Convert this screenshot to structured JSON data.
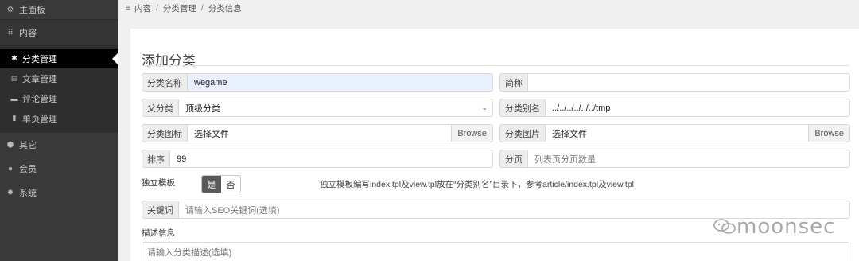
{
  "sidebar": {
    "home": {
      "icon": "dashboard-icon",
      "label": "主面板"
    },
    "content": {
      "icon": "grid-icon",
      "label": "内容"
    },
    "content_items": [
      {
        "icon": "asterisk-icon",
        "label": "分类管理",
        "active": true
      },
      {
        "icon": "book-icon",
        "label": "文章管理"
      },
      {
        "icon": "comment-icon",
        "label": "评论管理"
      },
      {
        "icon": "file-icon",
        "label": "单页管理"
      }
    ],
    "sections": [
      {
        "icon": "cube-icon",
        "label": "其它"
      },
      {
        "icon": "user-icon",
        "label": "会员"
      },
      {
        "icon": "gear-icon",
        "label": "系统"
      }
    ]
  },
  "breadcrumb": {
    "icon": "menu-icon",
    "items": [
      "内容",
      "分类管理",
      "分类信息"
    ],
    "separator": "/"
  },
  "form": {
    "title": "添加分类",
    "name": {
      "label": "分类名称",
      "value": "wegame"
    },
    "short": {
      "label": "简称",
      "value": ""
    },
    "parent": {
      "label": "父分类",
      "value": "顶级分类"
    },
    "alias": {
      "label": "分类别名",
      "value": "../../../../../../tmp"
    },
    "cat_icon": {
      "label": "分类图标",
      "value": "选择文件",
      "button": "Browse"
    },
    "cat_image": {
      "label": "分类图片",
      "value": "选择文件",
      "button": "Browse"
    },
    "sort": {
      "label": "排序",
      "value": "99"
    },
    "paging": {
      "label": "分页",
      "placeholder": "列表页分页数量"
    },
    "independent": {
      "label": "独立模板",
      "yes": "是",
      "no": "否",
      "selected": "是",
      "hint": "独立模板编写index.tpl及view.tpl放在“分类别名”目录下，参考article/index.tpl及view.tpl"
    },
    "keywords": {
      "label": "关键词",
      "placeholder": "请输入SEO关键词(选填)"
    },
    "description": {
      "label": "描述信息",
      "placeholder": "请输入分类描述(选填)"
    }
  },
  "watermark": {
    "text": "moonsec",
    "icon": "wechat-icon"
  }
}
